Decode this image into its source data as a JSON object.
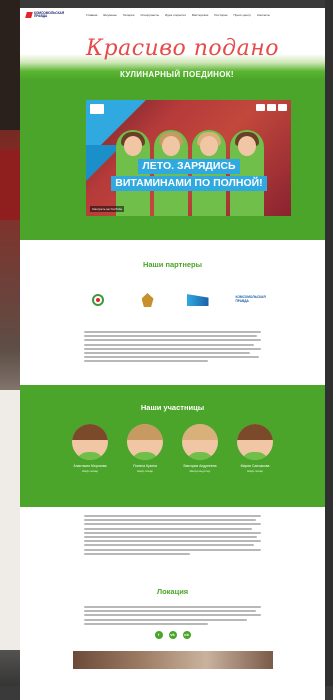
{
  "header": {
    "logo_text": "КОМСОМОЛЬСКАЯ ПРАВДА",
    "nav": [
      "Главная",
      "Шоумены",
      "Галерея",
      "Спецпроекты",
      "Идея открытия",
      "Мастерские",
      "Ресторан",
      "Пресс-центр",
      "Контакты"
    ]
  },
  "hero": {
    "script_title": "Красиво подано",
    "subtitle": "КУЛИНАРНЫЙ ПОЕДИНОК!"
  },
  "video": {
    "title_line1": "ЛЕТО. ЗАРЯДИСЬ",
    "title_line2": "ВИТАМИНАМИ ПО ПОЛНОЙ!",
    "footer": "Смотреть на YouTube"
  },
  "partners": {
    "title": "Наши партнеры",
    "logos": [
      {
        "icon": "circle-emblem-icon"
      },
      {
        "icon": "eagle-emblem-icon"
      },
      {
        "icon": "wave-logo-icon"
      },
      {
        "icon": "text-logo-icon",
        "text": "КОМСОМОЛЬСКАЯ ПРАВДА"
      }
    ]
  },
  "participants": {
    "title": "Наши участницы",
    "people": [
      {
        "name": "Анастасия Морозова",
        "role": "Шеф-повар"
      },
      {
        "name": "Полина Кузина",
        "role": "Шеф-повар"
      },
      {
        "name": "Виктория Андреевна",
        "role": "Шеф-кондитер"
      },
      {
        "name": "Мария Сапожкова",
        "role": "Шеф-повар"
      }
    ]
  },
  "location": {
    "title": "Локация",
    "socials": [
      "f",
      "vk",
      "ok"
    ]
  },
  "colors": {
    "brand_green": "#4aa52a",
    "accent_red": "#e64a4a",
    "accent_blue": "#2fa9df"
  }
}
